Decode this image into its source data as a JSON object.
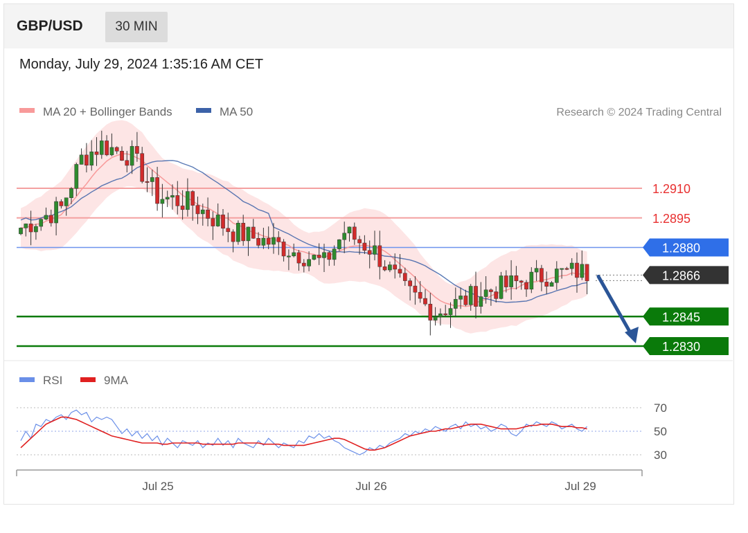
{
  "header": {
    "pair": "GBP/USD",
    "timeframe": "30 MIN"
  },
  "datetime": "Monday, July 29, 2024 1:35:16 AM CET",
  "legend": {
    "ma20": {
      "label": "MA 20 + Bollinger Bands",
      "color": "#f89a9a"
    },
    "ma50": {
      "label": "MA 50",
      "color": "#3c62a8"
    },
    "credit": "Research © 2024 Trading Central"
  },
  "rsi_legend": {
    "rsi": {
      "label": "RSI",
      "color": "#6a8fe8"
    },
    "ma9": {
      "label": "9MA",
      "color": "#e02020"
    }
  },
  "chart_data": {
    "type": "candlestick",
    "price_ylim": [
      1.2824,
      1.2944
    ],
    "levels": [
      {
        "value": "1.2910",
        "kind": "resistance",
        "color": "#e83030"
      },
      {
        "value": "1.2895",
        "kind": "resistance",
        "color": "#e83030"
      },
      {
        "value": "1.2880",
        "kind": "pivot",
        "color": "#2f6fe8"
      },
      {
        "value": "1.2866",
        "kind": "current",
        "color": "#333333"
      },
      {
        "value": "1.2845",
        "kind": "support",
        "color": "#0a7a0a"
      },
      {
        "value": "1.2830",
        "kind": "support",
        "color": "#0a7a0a"
      }
    ],
    "forecast_arrow": {
      "from": 1.2866,
      "to": 1.283,
      "color": "#2b5597"
    },
    "x_ticks": [
      "Jul 25",
      "Jul 26",
      "Jul 29"
    ],
    "rsi": {
      "ylim": [
        20,
        80
      ],
      "ticks": [
        "70",
        "50",
        "30"
      ],
      "rsi_values": [
        42,
        50,
        44,
        56,
        54,
        60,
        58,
        62,
        64,
        60,
        66,
        68,
        64,
        66,
        58,
        62,
        60,
        62,
        60,
        54,
        48,
        52,
        46,
        50,
        44,
        48,
        42,
        46,
        38,
        44,
        40,
        36,
        42,
        40,
        38,
        42,
        36,
        40,
        38,
        44,
        38,
        42,
        36,
        44,
        40,
        38,
        36,
        42,
        38,
        44,
        40,
        36,
        40,
        38,
        36,
        42,
        40,
        46,
        44,
        48,
        44,
        46,
        42,
        40,
        36,
        34,
        32,
        30,
        32,
        36,
        34,
        38,
        36,
        40,
        42,
        44,
        48,
        46,
        50,
        48,
        52,
        50,
        54,
        52,
        50,
        54,
        56,
        52,
        58,
        54,
        56,
        52,
        54,
        50,
        52,
        56,
        54,
        48,
        46,
        50,
        56,
        54,
        58,
        56,
        54,
        58,
        56,
        52,
        54,
        56,
        52,
        50,
        54
      ],
      "ma9_values": [
        36,
        40,
        44,
        48,
        52,
        56,
        58,
        60,
        62,
        62,
        61,
        60,
        58,
        56,
        54,
        52,
        50,
        48,
        46,
        45,
        44,
        43,
        42,
        41,
        40,
        40,
        40,
        40,
        39,
        39,
        40,
        40,
        40,
        40,
        40,
        40,
        39,
        39,
        39,
        39,
        39,
        39,
        39,
        40,
        40,
        40,
        40,
        40,
        39,
        39,
        39,
        39,
        38,
        38,
        38,
        38,
        38,
        39,
        40,
        41,
        42,
        43,
        44,
        44,
        43,
        41,
        39,
        37,
        35,
        34,
        34,
        35,
        36,
        38,
        40,
        42,
        44,
        46,
        47,
        48,
        49,
        50,
        50,
        51,
        52,
        52,
        53,
        54,
        55,
        56,
        56,
        56,
        55,
        54,
        53,
        52,
        52,
        52,
        52,
        53,
        54,
        55,
        55,
        56,
        56,
        56,
        55,
        54,
        54,
        54,
        53,
        53,
        52
      ]
    }
  }
}
